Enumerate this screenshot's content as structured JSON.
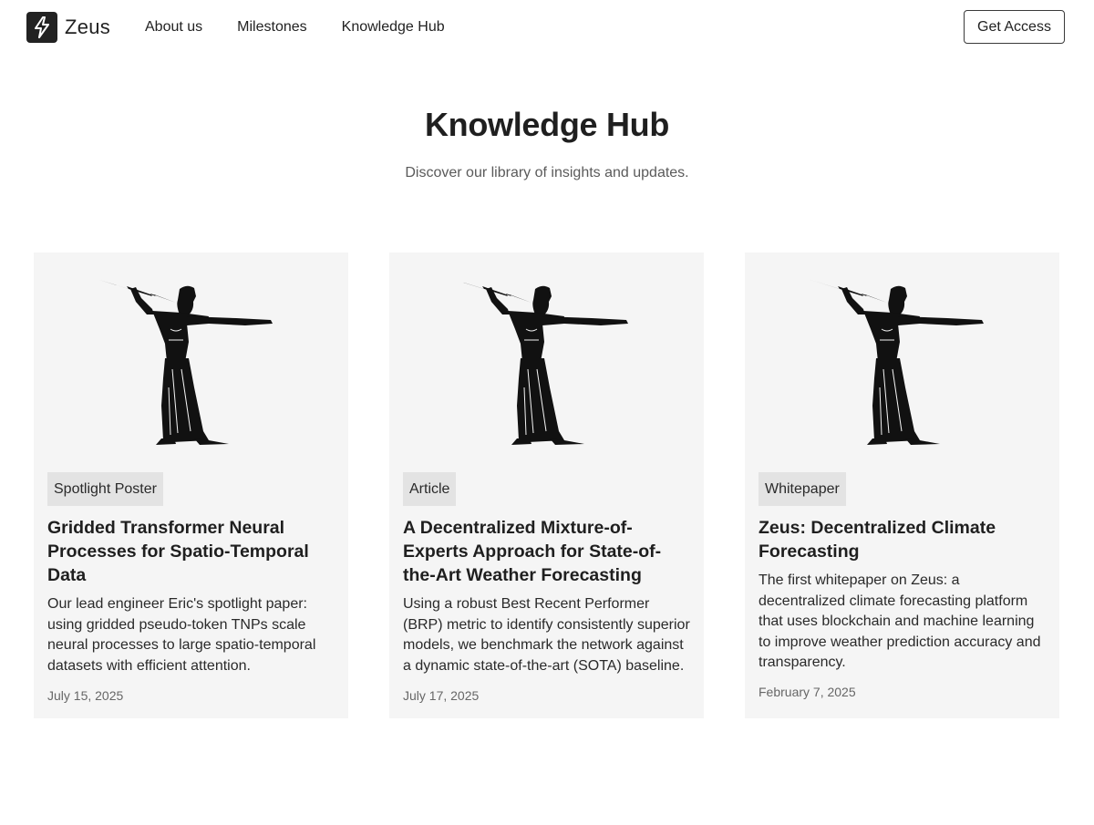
{
  "header": {
    "brand": "Zeus",
    "nav": [
      "About us",
      "Milestones",
      "Knowledge Hub"
    ],
    "cta_label": "Get Access"
  },
  "hero": {
    "title": "Knowledge Hub",
    "subtitle": "Discover our library of insights and updates."
  },
  "cards": [
    {
      "tag": "Spotlight Poster",
      "title": "Gridded Transformer Neural Processes for Spatio-Temporal Data",
      "description": "Our lead engineer Eric's spotlight paper: using gridded pseudo-token TNPs scale neural processes to large spatio-temporal datasets with efficient attention.",
      "date": "July 15, 2025",
      "image_icon": "zeus-figure-icon"
    },
    {
      "tag": "Article",
      "title": "A Decentralized Mixture-of-Experts Approach for State-of-the-Art Weather Forecasting",
      "description": "Using a robust Best Recent Performer (BRP) metric to identify consistently superior models, we benchmark the network against a dynamic state-of-the-art (SOTA) baseline.",
      "date": "July 17, 2025",
      "image_icon": "zeus-figure-icon"
    },
    {
      "tag": "Whitepaper",
      "title": "Zeus: Decentralized Climate Forecasting",
      "description": "The first whitepaper on Zeus: a decentralized climate forecasting platform that uses blockchain and machine learning to improve weather prediction accuracy and transparency.",
      "date": "February 7, 2025",
      "image_icon": "zeus-figure-icon"
    }
  ],
  "colors": {
    "card_bg": "#f5f5f5",
    "badge_bg": "#e3e3e3",
    "text": "#1f1f1f",
    "muted": "#5a5a5a"
  }
}
